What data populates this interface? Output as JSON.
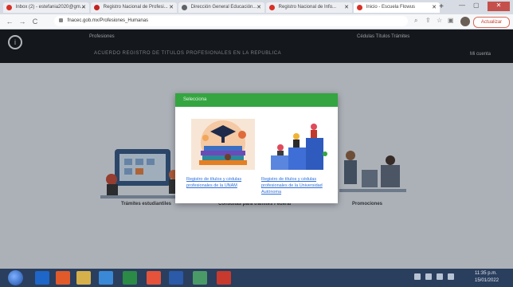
{
  "browser": {
    "tabs": [
      {
        "label": "Inbox (2) - estefania2020@gm..."
      },
      {
        "label": "Registro Nacional de Profesi..."
      },
      {
        "label": "Dirección General Educación..."
      },
      {
        "label": "Registro Nacional de Info..."
      },
      {
        "label": "Inicio - Escuela Flowus"
      }
    ],
    "address": "fnacec.gob.mx/Profesiones_Humanas",
    "update_label": "Actualizar"
  },
  "page": {
    "nav_left": "Profesiones",
    "nav_right": "Cédulas   Títulos   Trámites",
    "nav_far_right": "Mi cuenta",
    "heading": "ACUERDO REGISTRO DE TITULOS PROFESIONALES EN LA REPUBLICA",
    "cards": [
      {
        "label": "Trámites estudiantiles"
      },
      {
        "label": "Consultas para trámites Federal"
      },
      {
        "label": "Promociones"
      }
    ]
  },
  "modal": {
    "title": "Selecciona",
    "options": [
      {
        "link": "Registro de títulos y cédulas profesionales de la UNAM"
      },
      {
        "link": "Registro de títulos y cédulas profesionales de la Universidad Autónoma"
      }
    ]
  },
  "taskbar": {
    "time": "11:35 p.m.",
    "date": "15/01/2022"
  }
}
